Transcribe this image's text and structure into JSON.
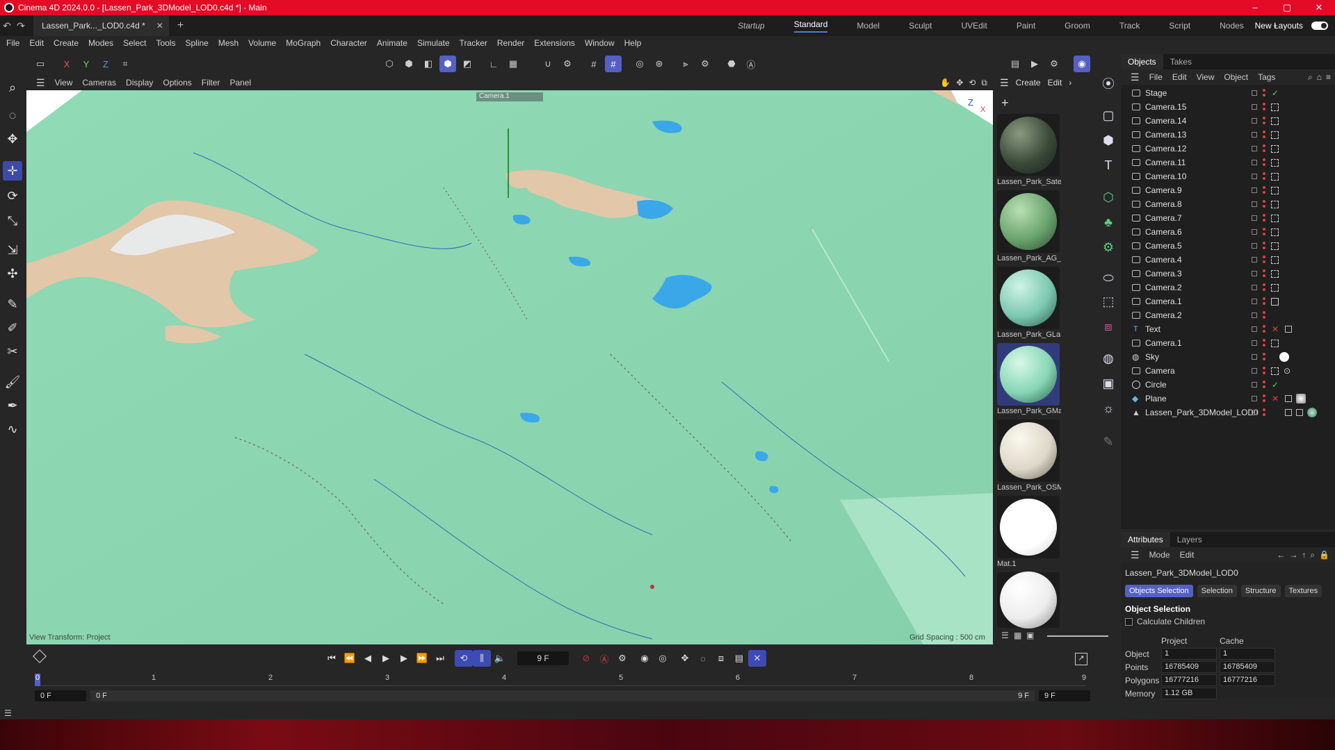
{
  "window": {
    "title": "Cinema 4D 2024.0.0 - [Lassen_Park_3DModel_LOD0.c4d *] - Main",
    "minimize": "–",
    "maximize": "▢",
    "close": "✕"
  },
  "tabs": {
    "document": "Lassen_Park..._LOD0.c4d *",
    "close": "✕",
    "add": "+"
  },
  "layouts": {
    "items": [
      "Startup",
      "Standard",
      "Model",
      "Sculpt",
      "UVEdit",
      "Paint",
      "Groom",
      "Track",
      "Script",
      "Nodes",
      "+"
    ],
    "active": "Standard",
    "new_layouts": "New Layouts"
  },
  "menu": [
    "File",
    "Edit",
    "Create",
    "Modes",
    "Select",
    "Tools",
    "Spline",
    "Mesh",
    "Volume",
    "MoGraph",
    "Character",
    "Animate",
    "Simulate",
    "Tracker",
    "Render",
    "Extensions",
    "Window",
    "Help"
  ],
  "toolbar": {
    "axes": [
      "X",
      "Y",
      "Z"
    ]
  },
  "viewport": {
    "menu": [
      "View",
      "Cameras",
      "Display",
      "Options",
      "Filter",
      "Panel"
    ],
    "camera_label": "Camera.1",
    "view_transform": "View Transform: Project",
    "grid_spacing": "Grid Spacing : 500 cm",
    "axis_z": "Z",
    "axis_x": "X",
    "colors": {
      "terrain": "#8fd8b5",
      "sand": "#e2c7a8",
      "water": "#3aa8e8",
      "snow": "#e8eaea"
    }
  },
  "materials": {
    "menu": [
      "Create",
      "Edit"
    ],
    "items": [
      {
        "name": "Lassen_Park_Satel",
        "color": "#3a4a38"
      },
      {
        "name": "Lassen_Park_AG_L",
        "color": "#6aa36e"
      },
      {
        "name": "Lassen_Park_GLan",
        "color": "#7cc8b0"
      },
      {
        "name": "Lassen_Park_GMa",
        "color": "#86d6b4"
      },
      {
        "name": "Lassen_Park_OSM",
        "color": "#ddd8c8"
      },
      {
        "name": "Mat.1",
        "color": "#ffffff"
      },
      {
        "name": "",
        "color": "#f2f2f2"
      }
    ]
  },
  "objects": {
    "tabs": [
      "Objects",
      "Takes"
    ],
    "menu": [
      "File",
      "Edit",
      "View",
      "Object",
      "Tags"
    ],
    "items": [
      {
        "name": "Stage"
      },
      {
        "name": "Camera.15"
      },
      {
        "name": "Camera.14"
      },
      {
        "name": "Camera.13"
      },
      {
        "name": "Camera.12"
      },
      {
        "name": "Camera.11"
      },
      {
        "name": "Camera.10"
      },
      {
        "name": "Camera.9"
      },
      {
        "name": "Camera.8"
      },
      {
        "name": "Camera.7"
      },
      {
        "name": "Camera.6"
      },
      {
        "name": "Camera.5"
      },
      {
        "name": "Camera.4"
      },
      {
        "name": "Camera.3"
      },
      {
        "name": "Camera.2"
      },
      {
        "name": "Camera.1"
      },
      {
        "name": "Camera.2"
      },
      {
        "name": "Text"
      },
      {
        "name": "Camera.1"
      },
      {
        "name": "Sky"
      },
      {
        "name": "Camera"
      },
      {
        "name": "Circle"
      },
      {
        "name": "Plane"
      },
      {
        "name": "Lassen_Park_3DModel_LOD0"
      }
    ]
  },
  "attributes": {
    "tabs": [
      "Attributes",
      "Layers"
    ],
    "menu": [
      "Mode",
      "Edit"
    ],
    "object_name": "Lassen_Park_3DModel_LOD0",
    "buttons": [
      "Objects Selection",
      "Selection",
      "Structure",
      "Textures"
    ],
    "section": "Object Selection",
    "calc_children": "Calculate Children",
    "col_project": "Project",
    "col_cache": "Cache",
    "rows": [
      {
        "label": "Object",
        "project": "1",
        "cache": "1"
      },
      {
        "label": "Points",
        "project": "16785409",
        "cache": "16785409"
      },
      {
        "label": "Polygons",
        "project": "16777216",
        "cache": "16777216"
      },
      {
        "label": "Memory",
        "project": "1.12 GB",
        "cache": ""
      }
    ]
  },
  "timeline": {
    "current_frame": "9 F",
    "ruler": [
      "0",
      "1",
      "2",
      "3",
      "4",
      "5",
      "6",
      "7",
      "8",
      "9"
    ],
    "start": "0 F",
    "range_start": "0 F",
    "range_end": "9 F",
    "end": "9 F"
  }
}
